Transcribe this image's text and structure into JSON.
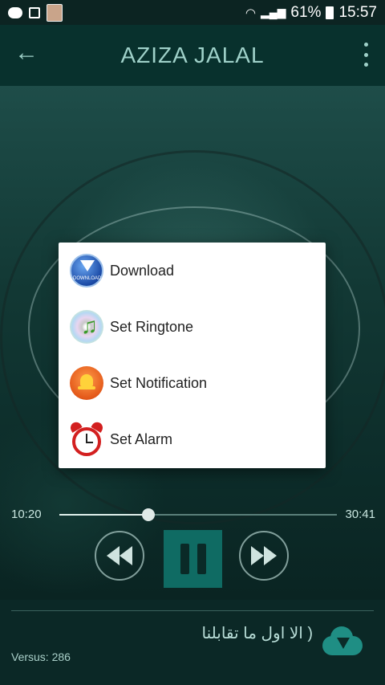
{
  "status_bar": {
    "battery": "61%",
    "time": "15:57"
  },
  "app_bar": {
    "title": "AZIZA JALAL"
  },
  "menu": {
    "items": [
      {
        "label": "Download",
        "icon": "download-icon",
        "icon_text": "DOWNLOAD"
      },
      {
        "label": "Set Ringtone",
        "icon": "music-note-icon"
      },
      {
        "label": "Set Notification",
        "icon": "bell-icon"
      },
      {
        "label": "Set Alarm",
        "icon": "alarm-clock-icon"
      }
    ]
  },
  "player": {
    "elapsed": "10:20",
    "duration": "30:41",
    "progress": 0.32,
    "track_title": "( الا اول ما تقابلنا",
    "versus_label": "Versus: 286"
  },
  "colors": {
    "accent": "#0f6b63",
    "background": "#0b2826"
  }
}
